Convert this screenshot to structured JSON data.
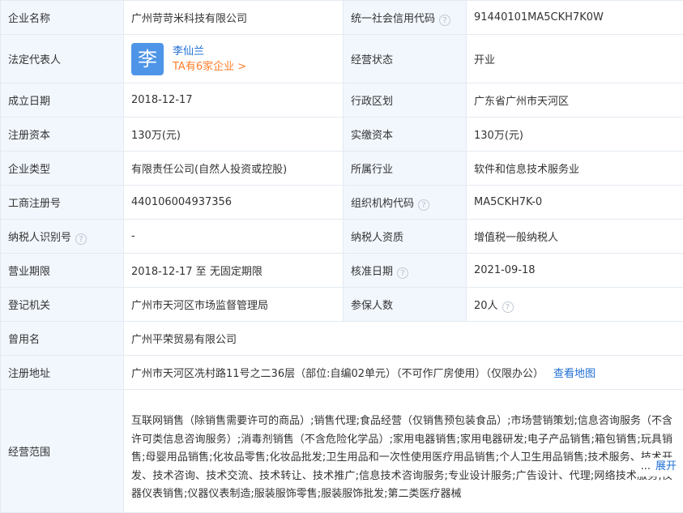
{
  "fields": {
    "company_name": {
      "label": "企业名称",
      "value": "广州苛苛米科技有限公司"
    },
    "credit_code": {
      "label": "统一社会信用代码",
      "value": "91440101MA5CKH7K0W"
    },
    "legal_rep": {
      "label": "法定代表人",
      "avatar_char": "李",
      "name": "李仙兰",
      "companies_link": "TA有6家企业 >"
    },
    "business_status": {
      "label": "经营状态",
      "value": "开业"
    },
    "established_date": {
      "label": "成立日期",
      "value": "2018-12-17"
    },
    "admin_region": {
      "label": "行政区划",
      "value": "广东省广州市天河区"
    },
    "registered_capital": {
      "label": "注册资本",
      "value": "130万(元)"
    },
    "paid_capital": {
      "label": "实缴资本",
      "value": "130万(元)"
    },
    "company_type": {
      "label": "企业类型",
      "value": "有限责任公司(自然人投资或控股)"
    },
    "industry": {
      "label": "所属行业",
      "value": "软件和信息技术服务业"
    },
    "reg_number": {
      "label": "工商注册号",
      "value": "440106004937356"
    },
    "org_code": {
      "label": "组织机构代码",
      "value": "MA5CKH7K-0"
    },
    "taxpayer_id": {
      "label": "纳税人识别号",
      "value": "-"
    },
    "taxpayer_qual": {
      "label": "纳税人资质",
      "value": "增值税一般纳税人"
    },
    "business_term": {
      "label": "营业期限",
      "value": "2018-12-17 至 无固定期限"
    },
    "approval_date": {
      "label": "核准日期",
      "value": "2021-09-18"
    },
    "reg_authority": {
      "label": "登记机关",
      "value": "广州市天河区市场监督管理局"
    },
    "insured_count": {
      "label": "参保人数",
      "value": "20人"
    },
    "former_name": {
      "label": "曾用名",
      "value": "广州平荣贸易有限公司"
    },
    "address": {
      "label": "注册地址",
      "value": "广州市天河区冼村路11号之二36层（部位:自编02单元）（不可作厂房使用）（仅限办公）",
      "map_link": "查看地图"
    },
    "scope": {
      "label": "经营范围",
      "value": "互联网销售（除销售需要许可的商品）;销售代理;食品经营（仅销售预包装食品）;市场营销策划;信息咨询服务（不含许可类信息咨询服务）;消毒剂销售（不含危险化学品）;家用电器销售;家用电器研发;电子产品销售;箱包销售;玩具销售;母婴用品销售;化妆品零售;化妆品批发;卫生用品和一次性使用医疗用品销售;个人卫生用品销售;技术服务、技术开发、技术咨询、技术交流、技术转让、技术推广;信息技术咨询服务;专业设计服务;广告设计、代理;网络技术服务;仪器仪表销售;仪器仪表制造;服装服饰零售;服装服饰批发;第二类医疗器械",
      "ellipsis": "...",
      "expand": "展开"
    }
  },
  "help_glyph": "?",
  "colors": {
    "label_bg": "#f2f7fe",
    "border": "#e4eaf2",
    "link": "#1f6ed4",
    "orange": "#ff7e2a",
    "avatar": "#4e95e8"
  }
}
